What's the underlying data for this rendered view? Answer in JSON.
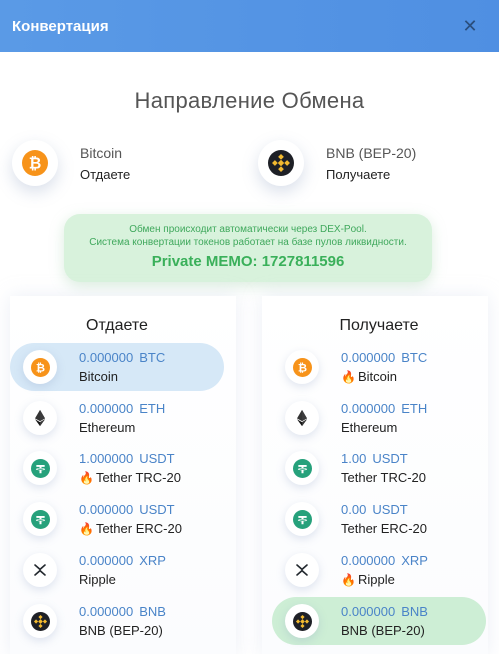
{
  "header": {
    "title": "Конвертация",
    "close": "✕"
  },
  "main_title": "Направление Обмена",
  "pair": {
    "give": {
      "name": "Bitcoin",
      "role": "Отдаете",
      "icon": "bitcoin-icon"
    },
    "get": {
      "name": "BNB (BEP-20)",
      "role": "Получаете",
      "icon": "bnb-icon"
    }
  },
  "info": {
    "line1": "Обмен происходит автоматически через DEX-Pool.",
    "line2": "Система конвертации токенов работает на базе пулов ликвидности.",
    "memo": "Private MEMO: 1727811596"
  },
  "columns": {
    "give_title": "Отдаете",
    "get_title": "Получаете"
  },
  "give_list": [
    {
      "amount": "0.000000",
      "ticker": "BTC",
      "name": "Bitcoin",
      "fire": "",
      "icon": "bitcoin-icon",
      "selected": true
    },
    {
      "amount": "0.000000",
      "ticker": "ETH",
      "name": "Ethereum",
      "fire": "",
      "icon": "ethereum-icon",
      "selected": false
    },
    {
      "amount": "1.000000",
      "ticker": "USDT",
      "name": "Tether TRC-20",
      "fire": "🔥",
      "icon": "tether-icon",
      "selected": false
    },
    {
      "amount": "0.000000",
      "ticker": "USDT",
      "name": "Tether ERC-20",
      "fire": "🔥",
      "icon": "tether-icon",
      "selected": false
    },
    {
      "amount": "0.000000",
      "ticker": "XRP",
      "name": "Ripple",
      "fire": "",
      "icon": "ripple-icon",
      "selected": false
    },
    {
      "amount": "0.000000",
      "ticker": "BNB",
      "name": "BNB (BEP-20)",
      "fire": "",
      "icon": "bnb-icon",
      "selected": false
    }
  ],
  "get_list": [
    {
      "amount": "0.000000",
      "ticker": "BTC",
      "name": "Bitcoin",
      "fire": "🔥",
      "icon": "bitcoin-icon",
      "selected": false
    },
    {
      "amount": "0.000000",
      "ticker": "ETH",
      "name": "Ethereum",
      "fire": "",
      "icon": "ethereum-icon",
      "selected": false
    },
    {
      "amount": "1.00",
      "ticker": "USDT",
      "name": "Tether TRC-20",
      "fire": "",
      "icon": "tether-icon",
      "selected": false
    },
    {
      "amount": "0.00",
      "ticker": "USDT",
      "name": "Tether ERC-20",
      "fire": "",
      "icon": "tether-icon",
      "selected": false
    },
    {
      "amount": "0.000000",
      "ticker": "XRP",
      "name": "Ripple",
      "fire": "🔥",
      "icon": "ripple-icon",
      "selected": false
    },
    {
      "amount": "0.000000",
      "ticker": "BNB",
      "name": "BNB (BEP-20)",
      "fire": "",
      "icon": "bnb-icon",
      "selected": true
    }
  ],
  "colors": {
    "header": "#5a9ae6",
    "accent": "#4a84c8",
    "selected_give": "#d6e8f7",
    "selected_get": "#cdeed5",
    "info_text": "#3fa85c"
  }
}
